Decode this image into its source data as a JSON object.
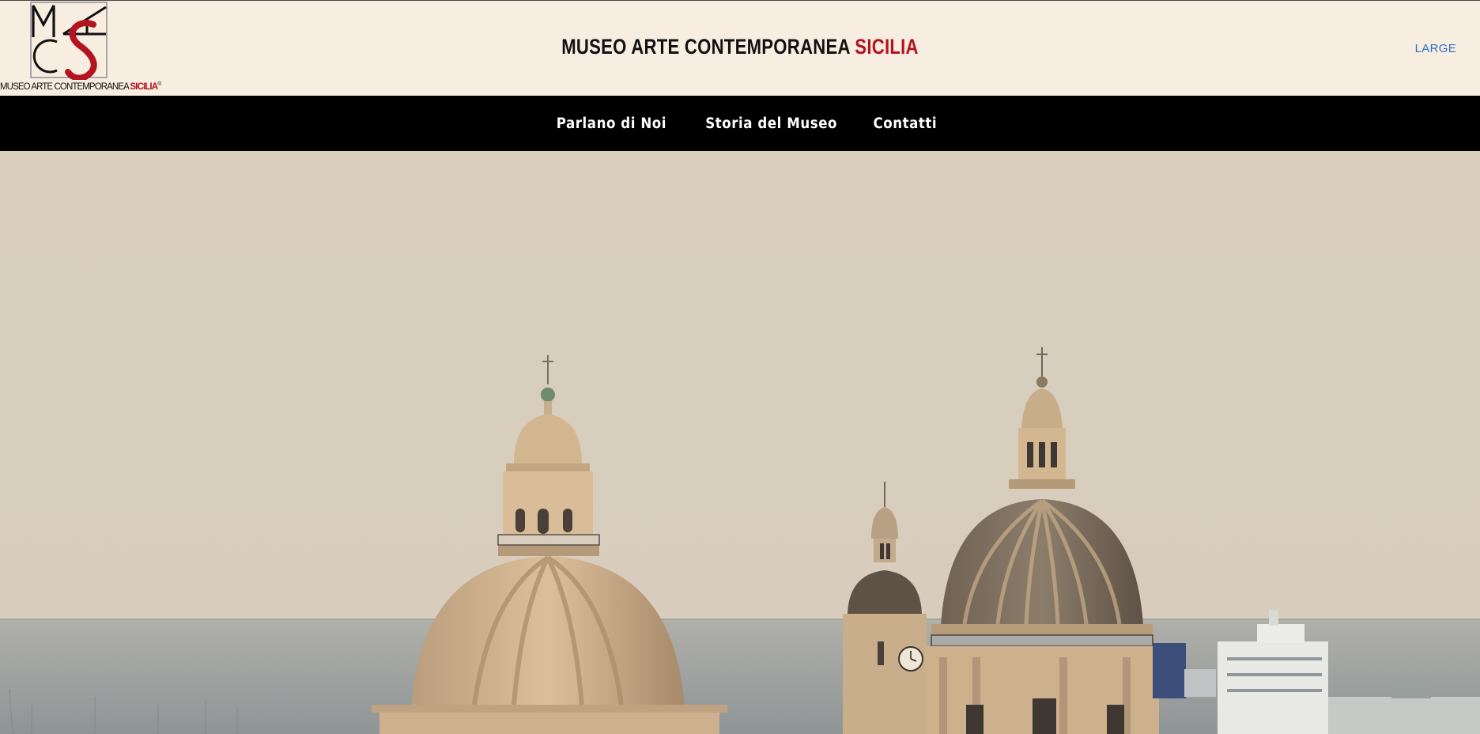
{
  "header": {
    "logo": {
      "text_main": "MUSEO ARTE CONTEMPORANEA",
      "text_accent": "SICILIA",
      "registered_mark": "®"
    },
    "title_main": "MUSEO ARTE CONTEMPORANEA",
    "title_accent": "SICILIA",
    "size_toggle_label": "LARGE"
  },
  "nav": {
    "items": [
      {
        "label": "Parlano di Noi"
      },
      {
        "label": "Storia del Museo"
      },
      {
        "label": "Contatti"
      }
    ]
  },
  "hero": {
    "image": "photo of baroque church domes against a hazy sky and sea with a ferry"
  },
  "colors": {
    "background": "#f8ede1",
    "nav_background": "#000000",
    "accent_red": "#b3141f",
    "link_blue": "#2a6fc9",
    "sky": "#d9cebd",
    "sea": "#9fa2a0"
  }
}
